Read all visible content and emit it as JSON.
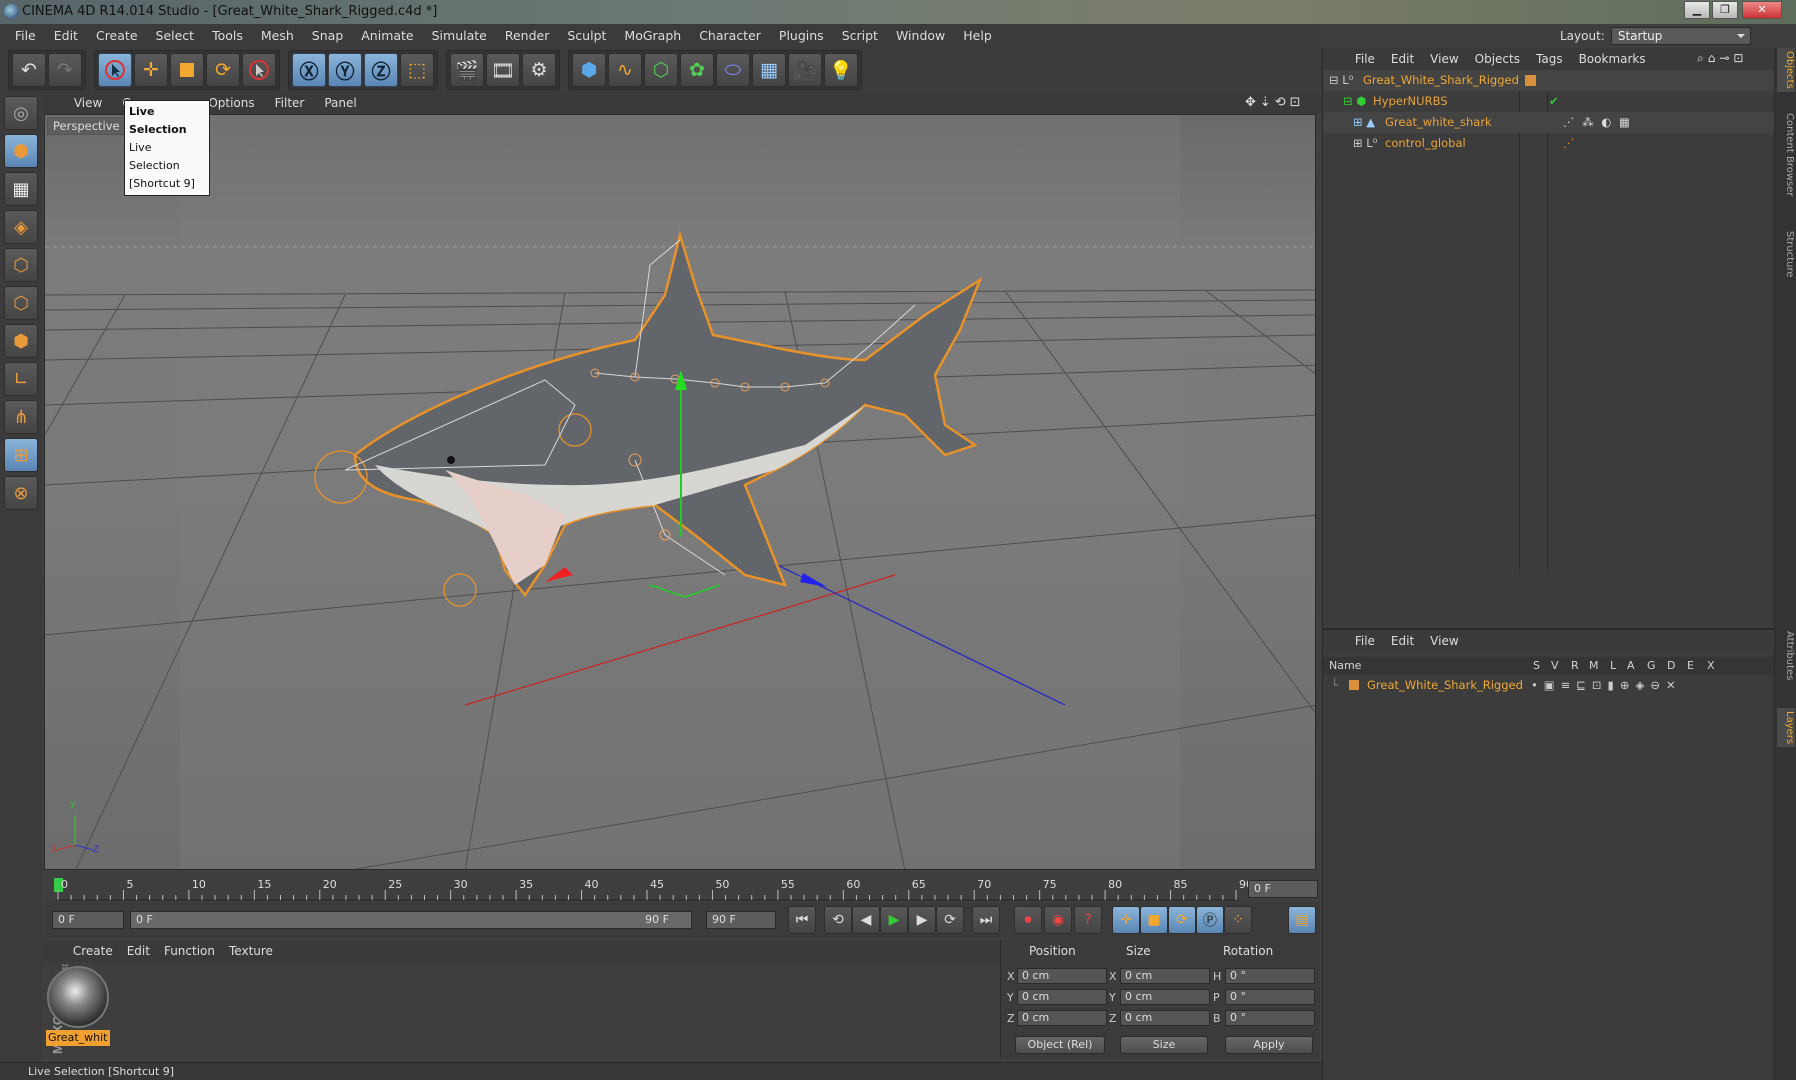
{
  "window": {
    "title": "CINEMA 4D R14.014 Studio - [Great_White_Shark_Rigged.c4d *]"
  },
  "menu": [
    "File",
    "Edit",
    "Create",
    "Select",
    "Tools",
    "Mesh",
    "Snap",
    "Animate",
    "Simulate",
    "Render",
    "Sculpt",
    "MoGraph",
    "Character",
    "Plugins",
    "Script",
    "Window",
    "Help"
  ],
  "layout": {
    "label": "Layout:",
    "value": "Startup"
  },
  "viewport": {
    "menu": [
      "View",
      "Cameras",
      "Display",
      "Options",
      "Filter",
      "Panel"
    ],
    "menu_visible": [
      "View",
      "Ca",
      "y",
      "Options",
      "Filter",
      "Panel"
    ],
    "name": "Perspective"
  },
  "tooltip": {
    "title": "Live Selection",
    "line1": "Live Selection",
    "line2": "[Shortcut 9]"
  },
  "timeline": {
    "ticks": [
      "0",
      "5",
      "10",
      "15",
      "20",
      "25",
      "30",
      "35",
      "40",
      "45",
      "50",
      "55",
      "60",
      "65",
      "70",
      "75",
      "80",
      "85",
      "90"
    ],
    "current": "0 F"
  },
  "transport": {
    "start": "0 F",
    "range_start": "0 F",
    "range_end": "90 F",
    "end": "90 F"
  },
  "material_menu": [
    "Create",
    "Edit",
    "Function",
    "Texture"
  ],
  "material": {
    "name": "Great_whit"
  },
  "coords": {
    "headers": [
      "Position",
      "Size",
      "Rotation"
    ],
    "pos": [
      {
        "axis": "X",
        "value": "0 cm"
      },
      {
        "axis": "Y",
        "value": "0 cm"
      },
      {
        "axis": "Z",
        "value": "0 cm"
      }
    ],
    "size": [
      {
        "axis": "X",
        "value": "0 cm"
      },
      {
        "axis": "Y",
        "value": "0 cm"
      },
      {
        "axis": "Z",
        "value": "0 cm"
      }
    ],
    "rot": [
      {
        "axis": "H",
        "value": "0 °"
      },
      {
        "axis": "P",
        "value": "0 °"
      },
      {
        "axis": "B",
        "value": "0 °"
      }
    ],
    "mode": "Object (Rel)",
    "size_mode": "Size",
    "apply": "Apply"
  },
  "status": "Live Selection [Shortcut 9]",
  "objects_menu": [
    "File",
    "Edit",
    "View",
    "Objects",
    "Tags",
    "Bookmarks"
  ],
  "objects": [
    {
      "name": "Great_White_Shark_Rigged",
      "color": "#e8a33a"
    },
    {
      "name": "HyperNURBS",
      "color": "#e8a33a"
    },
    {
      "name": "Great_white_shark",
      "color": "#e0903a"
    },
    {
      "name": "control_global",
      "color": "#e0903a"
    }
  ],
  "layers_menu": [
    "File",
    "Edit",
    "View"
  ],
  "layers": {
    "headers": [
      "Name",
      "S",
      "V",
      "R",
      "M",
      "L",
      "A",
      "G",
      "D",
      "E",
      "X"
    ],
    "row": "Great_White_Shark_Rigged"
  },
  "right_tabs": [
    "Objects",
    "Content Browser",
    "Structure",
    "Attributes",
    "Layers"
  ],
  "axis_gizmo": {
    "y": "Y",
    "x": "X",
    "z": "Z"
  },
  "colors": {
    "accent": "#e8a33a",
    "active": "#5a86b5",
    "bg": "#3c3c3c"
  }
}
